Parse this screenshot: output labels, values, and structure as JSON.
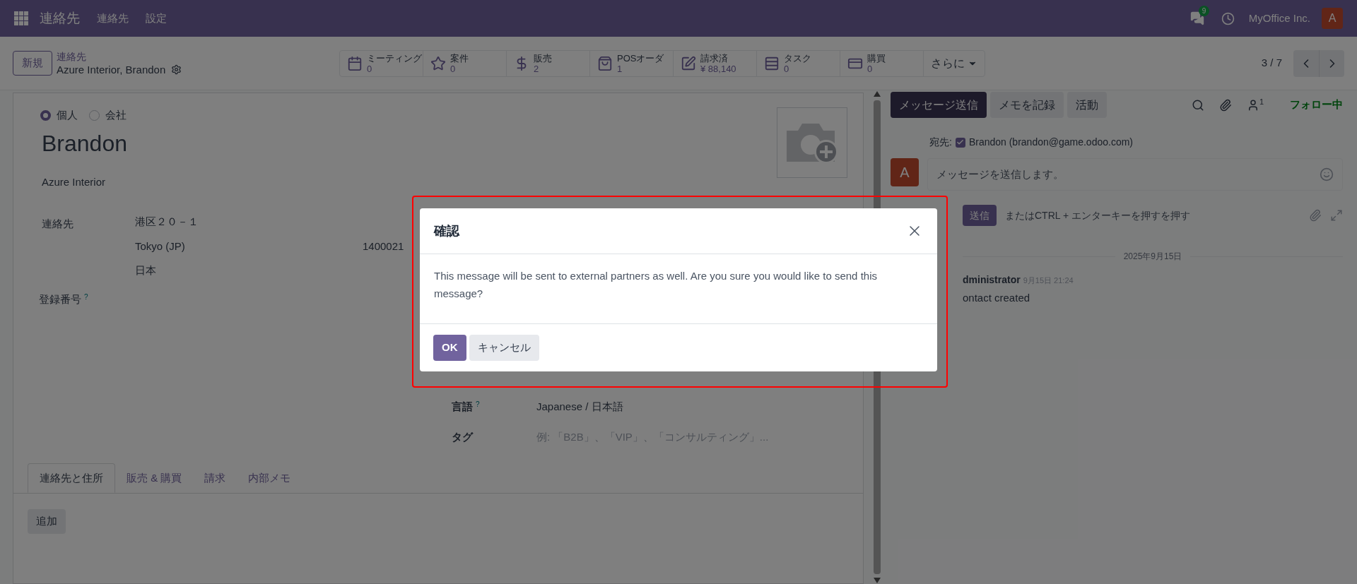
{
  "navbar": {
    "app_name": "連絡先",
    "menu": [
      "連絡先",
      "設定"
    ],
    "messages_badge": "9",
    "company": "MyOffice Inc.",
    "avatar": "A"
  },
  "control_panel": {
    "new_button": "新規",
    "breadcrumb": "連絡先",
    "record": "Azure Interior, Brandon",
    "stats": [
      {
        "label": "ミーティング",
        "value": "0"
      },
      {
        "label": "案件",
        "value": "0"
      },
      {
        "label": "販売",
        "value": "2"
      },
      {
        "label": "POSオーダ",
        "value": "1"
      },
      {
        "label": "請求済",
        "value": "¥ 88,140"
      },
      {
        "label": "タスク",
        "value": "0"
      },
      {
        "label": "購買",
        "value": "0"
      }
    ],
    "more": "さらに",
    "pager": "3 / 7"
  },
  "form": {
    "type_options": [
      {
        "label": "個人",
        "selected": true
      },
      {
        "label": "会社",
        "selected": false
      }
    ],
    "name": "Brandon",
    "company": "Azure Interior",
    "address_label": "連絡先",
    "street": "港区２０－１",
    "city": "Tokyo (JP)",
    "zip": "1400021",
    "country": "日本",
    "registration_label": "登録番号",
    "help_mark": "?",
    "language_label": "言語",
    "language_help": "?",
    "language": "Japanese / 日本語",
    "tags_label": "タグ",
    "tags_placeholder": "例: 「B2B」、「VIP」、「コンサルティング」...",
    "tabs": [
      {
        "label": "連絡先と住所",
        "selected": true
      },
      {
        "label": "販売 & 購買",
        "selected": false
      },
      {
        "label": "請求",
        "selected": false
      },
      {
        "label": "内部メモ",
        "selected": false
      }
    ],
    "add_button": "追加"
  },
  "chatter": {
    "buttons": [
      {
        "label": "メッセージ送信",
        "selected": true
      },
      {
        "label": "メモを記録",
        "selected": false
      },
      {
        "label": "活動",
        "selected": false
      }
    ],
    "followers_count": "1",
    "follow_status": "フォロー中",
    "recipient_label": "宛先:",
    "recipient": {
      "label": "Brandon (brandon@game.odoo.com)",
      "checked": true
    },
    "avatar": "A",
    "composer_placeholder": "メッセージを送信します。",
    "send_button": "送信",
    "send_hint": "またはCTRL + エンターキーを押すを押す",
    "date": "2025年9月15日",
    "message": {
      "author": "dministrator",
      "time": "9月15日 21:24",
      "body": "ontact created"
    }
  },
  "dialog": {
    "title": "確認",
    "body": "This message will be sent to external partners as well. Are you sure you would like to send this message?",
    "ok": "OK",
    "cancel": "キャンセル"
  }
}
